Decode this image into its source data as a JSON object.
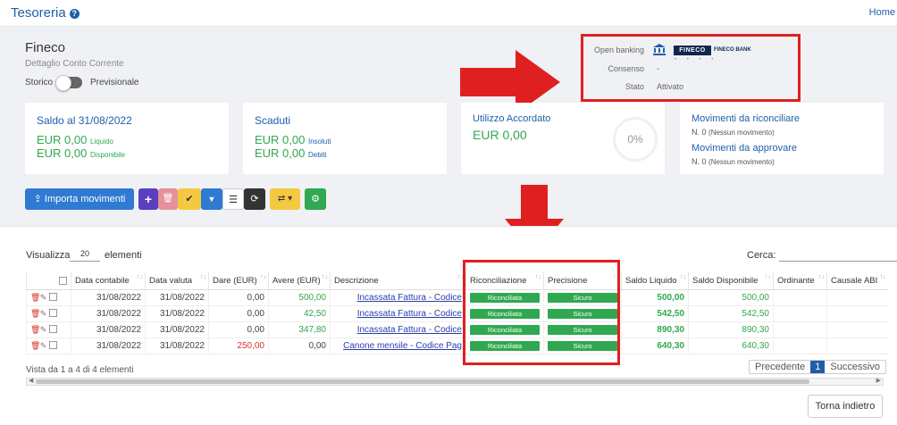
{
  "header": {
    "title": "Tesoreria",
    "help_icon": "?",
    "home_link": "Home"
  },
  "account": {
    "name": "Fineco",
    "subtitle": "Dettaglio Conto Corrente",
    "storico_label": "Storico",
    "previsionale_label": "Previsionale"
  },
  "open_banking": {
    "label": "Open banking",
    "logo_text": "FINECO",
    "bank_name": "FINECO BANK",
    "logo_dots": "• • • •",
    "consenso_label": "Consenso",
    "consenso_value": "-",
    "stato_label": "Stato",
    "stato_value": "Attivato"
  },
  "cards": {
    "saldo": {
      "title": "Saldo al 31/08/2022",
      "amount1": "EUR 0,00",
      "amount1_label": "Liquido",
      "amount2": "EUR 0,00",
      "amount2_label": "Disponibile"
    },
    "scaduti": {
      "title": "Scaduti",
      "amount1": "EUR 0,00",
      "amount1_label": "Insoluti",
      "amount2": "EUR 0,00",
      "amount2_label": "Debiti"
    },
    "utilizzo": {
      "title": "Utilizzo Accordato",
      "amount": "EUR 0,00",
      "gauge": "0%",
      "gauge_fraction": 0
    },
    "movimenti": {
      "riconciliare_title": "Movimenti da riconciliare",
      "riconciliare_count": "N. 0",
      "riconciliare_note": "(Nessun movimento)",
      "approvare_title": "Movimenti da approvare",
      "approvare_count": "N. 0",
      "approvare_note": "(Nessun movimento)"
    }
  },
  "toolbar": {
    "import_label": "Importa movimenti",
    "add_icon": "+",
    "delete_icon": "🗑",
    "check_icon": "✔",
    "filter_icon": "▼",
    "list_icon": "☰",
    "refresh_icon": "⟳",
    "exchange_icon": "⇄ ▾",
    "settings_icon": "⚙"
  },
  "table_controls": {
    "show_label": "Visualizza",
    "show_value": "20",
    "elements_label": "elementi",
    "search_label": "Cerca:"
  },
  "columns": [
    "",
    "Data contabile",
    "Data valuta",
    "Dare (EUR)",
    "Avere (EUR)",
    "Descrizione",
    "Riconciliazione",
    "Precisione",
    "Saldo Liquido",
    "Saldo Disponibile",
    "Ordinante",
    "Causale ABI"
  ],
  "rows": [
    {
      "data_contabile": "31/08/2022",
      "data_valuta": "31/08/2022",
      "dare": "0,00",
      "avere": "500,00",
      "descrizione": "Incassata Fattura - Codice",
      "riconciliazione": "Riconciliata",
      "precisione": "Sicuro",
      "saldo_liquido": "500,00",
      "saldo_disponibile": "500,00"
    },
    {
      "data_contabile": "31/08/2022",
      "data_valuta": "31/08/2022",
      "dare": "0,00",
      "avere": "42,50",
      "descrizione": "Incassata Fattura - Codice",
      "riconciliazione": "Riconciliata",
      "precisione": "Sicuro",
      "saldo_liquido": "542,50",
      "saldo_disponibile": "542,50"
    },
    {
      "data_contabile": "31/08/2022",
      "data_valuta": "31/08/2022",
      "dare": "0,00",
      "avere": "347,80",
      "descrizione": "Incassata Fattura - Codice",
      "riconciliazione": "Riconciliata",
      "precisione": "Sicuro",
      "saldo_liquido": "890,30",
      "saldo_disponibile": "890,30"
    },
    {
      "data_contabile": "31/08/2022",
      "data_valuta": "31/08/2022",
      "dare": "250,00",
      "avere": "0,00",
      "descrizione": "Canone mensile - Codice Pag",
      "riconciliazione": "Riconciliata",
      "precisione": "Sicuro",
      "saldo_liquido": "640,30",
      "saldo_disponibile": "640,30"
    }
  ],
  "footer": {
    "summary": "Vista da 1 a 4 di 4 elementi",
    "prev_label": "Precedente",
    "current_page": "1",
    "next_label": "Successivo",
    "back_label": "Torna indietro"
  },
  "colors": {
    "accent": "#1f5fa8",
    "success": "#2fa84f",
    "danger": "#d9342b",
    "highlight": "#e02020"
  }
}
